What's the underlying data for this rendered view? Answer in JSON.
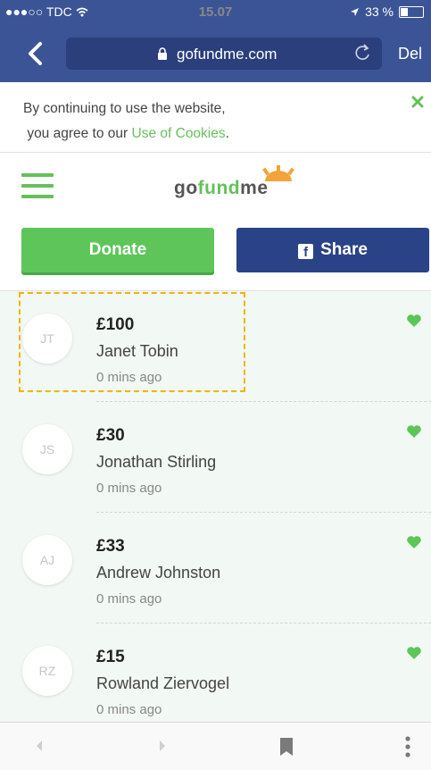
{
  "status_bar": {
    "carrier": "●●●○○ TDC",
    "time": "15.07",
    "battery": "33 %"
  },
  "browser": {
    "url": "gofundme.com",
    "del_label": "Del"
  },
  "cookie_notice": {
    "line1": "By continuing to use the website,",
    "line2_prefix": "you agree to our ",
    "link": "Use of Cookies",
    "line2_suffix": "."
  },
  "logo": {
    "part1": "go",
    "part2": "fund",
    "part3": "me"
  },
  "actions": {
    "donate_label": "Donate",
    "share_label": "Share"
  },
  "donations": [
    {
      "initials": "JT",
      "amount": "£100",
      "name": "Janet Tobin",
      "time": "0 mins ago"
    },
    {
      "initials": "JS",
      "amount": "£30",
      "name": "Jonathan Stirling",
      "time": "0 mins ago"
    },
    {
      "initials": "AJ",
      "amount": "£33",
      "name": "Andrew Johnston",
      "time": "0 mins ago"
    },
    {
      "initials": "RZ",
      "amount": "£15",
      "name": "Rowland Ziervogel",
      "time": "0 mins ago"
    }
  ],
  "colors": {
    "brand_green": "#65c05b",
    "facebook_blue": "#2a4386",
    "browser_blue": "#3b5496",
    "highlight": "#f1b400"
  }
}
